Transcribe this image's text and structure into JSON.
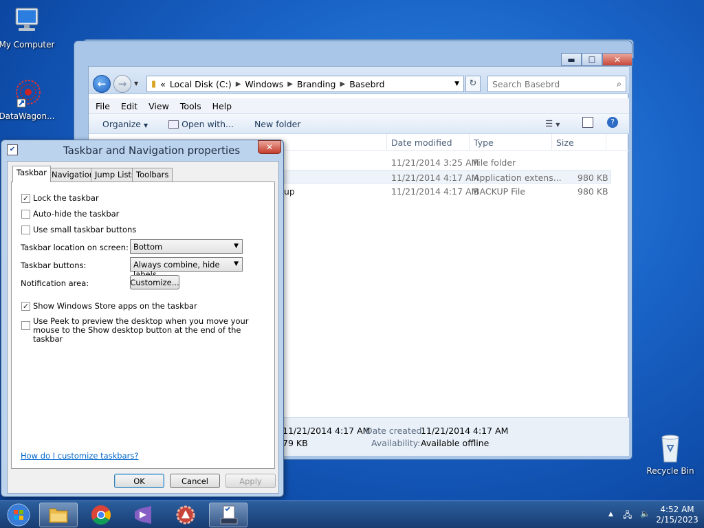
{
  "desktop": {
    "icons": [
      {
        "label": "My Computer"
      },
      {
        "label": "DataWagon..."
      },
      {
        "label": "Recycle Bin"
      }
    ]
  },
  "explorer": {
    "breadcrumb": {
      "chevron": "«",
      "parts": [
        "Local Disk (C:)",
        "Windows",
        "Branding",
        "Basebrd"
      ]
    },
    "search_placeholder": "Search Basebrd",
    "menu": [
      "File",
      "Edit",
      "View",
      "Tools",
      "Help"
    ],
    "toolbar": {
      "organize": "Organize",
      "open_with": "Open with...",
      "new_folder": "New folder"
    },
    "columns": {
      "date": "Date modified",
      "type": "Type",
      "size": "Size"
    },
    "files": [
      {
        "date": "11/21/2014 3:25 AM",
        "type": "File folder",
        "size": ""
      },
      {
        "date": "11/21/2014 4:17 AM",
        "type": "Application extens...",
        "size": "980 KB"
      },
      {
        "name_tail": "up",
        "date": "11/21/2014 4:17 AM",
        "type": "BACKUP File",
        "size": "980 KB"
      }
    ],
    "details": {
      "modified_value": "11/21/2014 4:17 AM",
      "size_value": "79 KB",
      "created_label": "Date created:",
      "created_value": "11/21/2014 4:17 AM",
      "availability_label": "Availability:",
      "availability_value": "Available offline"
    }
  },
  "dialog": {
    "title": "Taskbar and Navigation properties",
    "tabs": [
      "Taskbar",
      "Navigation",
      "Jump Lists",
      "Toolbars"
    ],
    "options": {
      "lock": {
        "label": "Lock the taskbar",
        "checked": true
      },
      "autohide": {
        "label": "Auto-hide the taskbar",
        "checked": false
      },
      "small": {
        "label": "Use small taskbar buttons",
        "checked": false
      },
      "store": {
        "label": "Show Windows Store apps on the taskbar",
        "checked": true
      },
      "peek": {
        "label": "Use Peek to preview the desktop when you move your mouse to the Show desktop button at the end of the taskbar",
        "checked": false
      }
    },
    "location": {
      "label": "Taskbar location on screen:",
      "value": "Bottom"
    },
    "buttons_setting": {
      "label": "Taskbar buttons:",
      "value": "Always combine, hide labels"
    },
    "notification": {
      "label": "Notification area:",
      "button": "Customize..."
    },
    "help_link": "How do I customize taskbars?",
    "ok": "OK",
    "cancel": "Cancel",
    "apply": "Apply"
  },
  "taskbar": {
    "time": "4:52 AM",
    "date": "2/15/2023",
    "tray_arrow": "▲"
  },
  "colors": {
    "desktop": "#1a64c8",
    "taskbar": "#173c72",
    "link": "#0066cc",
    "close": "#c43c2d"
  }
}
